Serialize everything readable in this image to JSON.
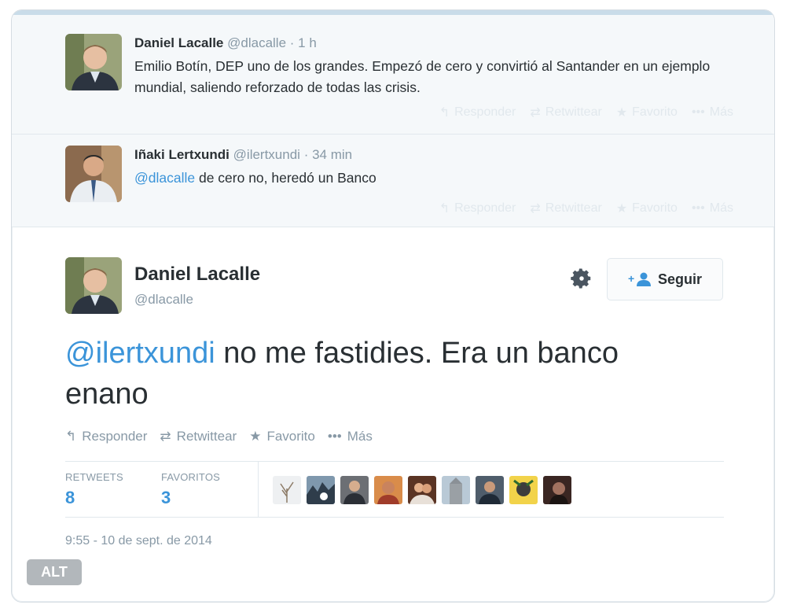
{
  "tweet1": {
    "name": "Daniel Lacalle",
    "handle": "@dlacalle",
    "time": "1 h",
    "text": "Emilio Botín, DEP uno de los grandes. Empezó de cero y convirtió al Santander en un ejemplo mundial, saliendo reforzado de todas las crisis."
  },
  "tweet2": {
    "name": "Iñaki Lertxundi",
    "handle": "@ilertxundi",
    "time": "34 min",
    "mention": "@dlacalle",
    "text": " de cero no, heredó un Banco"
  },
  "ghost_actions": {
    "reply": "Responder",
    "retweet": "Retwittear",
    "favorite": "Favorito",
    "more": "Más"
  },
  "main": {
    "name": "Daniel Lacalle",
    "handle": "@dlacalle",
    "follow_label": "Seguir",
    "mention": "@ilertxundi",
    "text": " no me fastidies. Era un banco enano",
    "actions": {
      "reply": "Responder",
      "retweet": "Retwittear",
      "favorite": "Favorito",
      "more": "Más"
    },
    "stats": {
      "retweets_label": "RETWEETS",
      "retweets": "8",
      "favorites_label": "FAVORITOS",
      "favorites": "3"
    },
    "timestamp": "9:55 - 10 de sept. de 2014"
  },
  "alt_badge": "ALT",
  "colors": {
    "link": "#3b94d9",
    "muted": "#8899a6",
    "text": "#292f33",
    "context_bg": "#f5f8fa"
  },
  "icons": [
    "reply-icon",
    "retweet-icon",
    "star-icon",
    "more-icon",
    "gear-icon",
    "follow-person-icon"
  ]
}
